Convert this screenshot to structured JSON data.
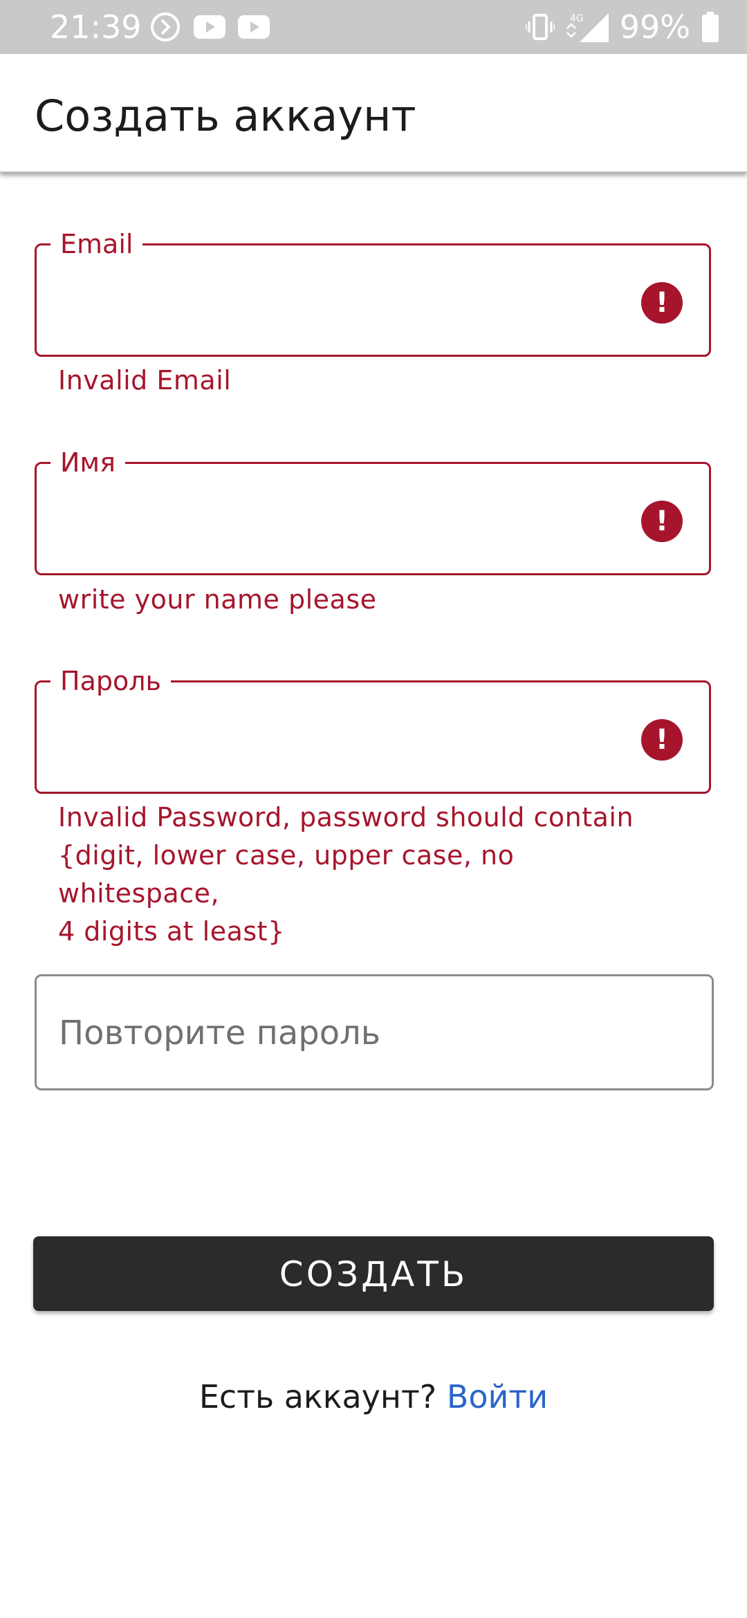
{
  "status_bar": {
    "time": "21:39",
    "battery": "99%",
    "network": "4G"
  },
  "app_bar": {
    "title": "Создать аккаунт"
  },
  "form": {
    "email": {
      "label": "Email",
      "value": "",
      "error": "Invalid Email"
    },
    "name": {
      "label": "Имя",
      "value": "",
      "error": "write your name please"
    },
    "password": {
      "label": "Пароль",
      "value": "",
      "error_lines": [
        "Invalid Password, password should contain",
        "{digit, lower case, upper case, no whitespace,",
        "4 digits at least}"
      ]
    },
    "repeat_password": {
      "placeholder": "Повторите пароль",
      "value": ""
    },
    "submit_label": "СОЗДАТЬ"
  },
  "footer": {
    "prompt": "Есть аккаунт?",
    "link": "Войти"
  },
  "colors": {
    "error": "#a6152c",
    "button": "#2b2b2b",
    "link": "#2a65c9",
    "status_bar": "#c9c9c9"
  }
}
